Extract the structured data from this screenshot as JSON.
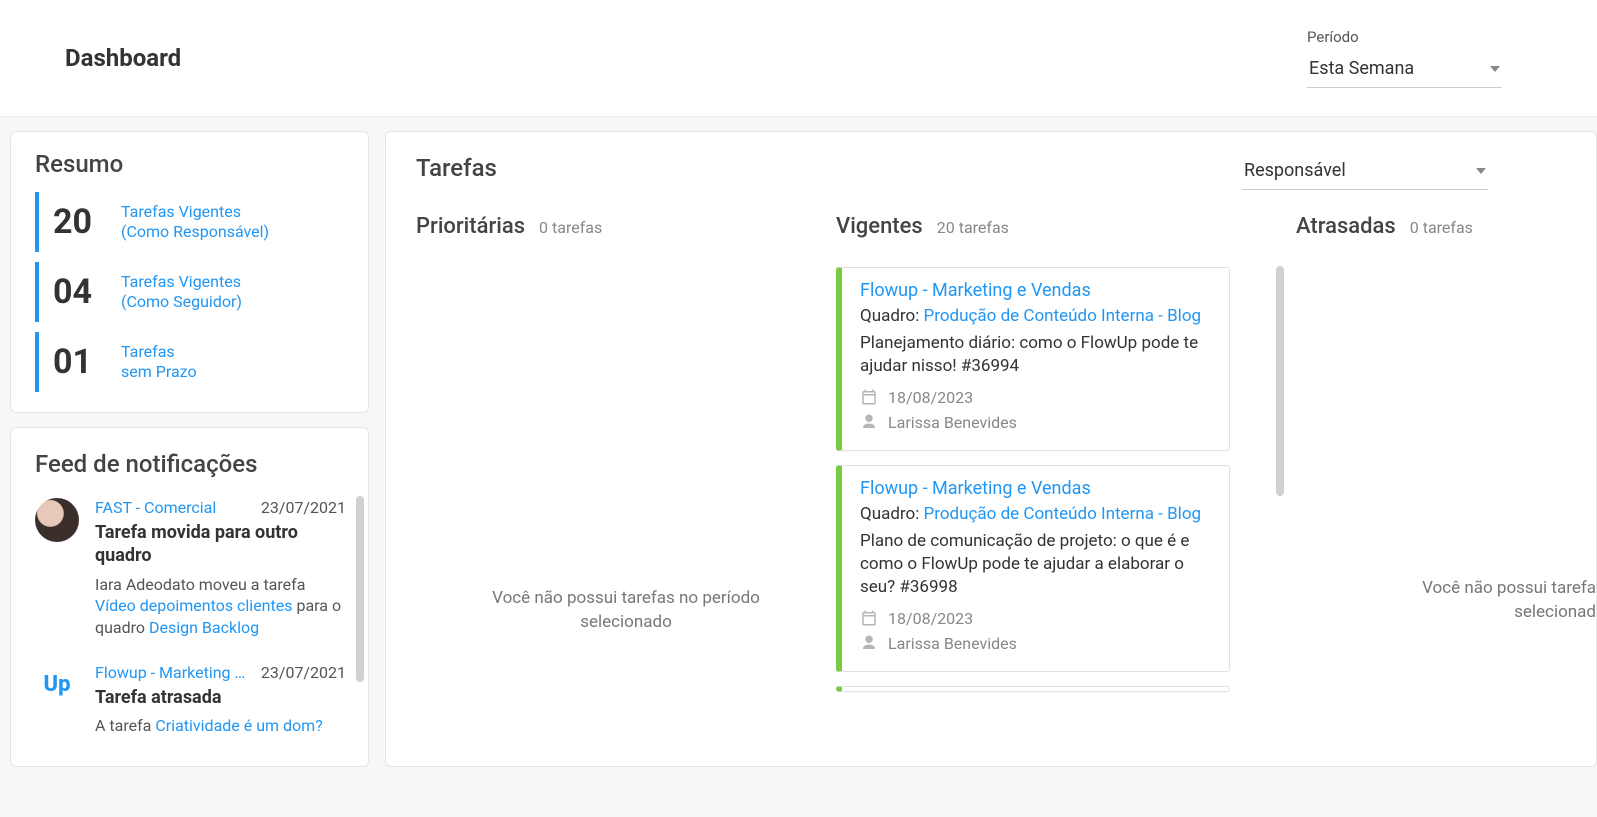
{
  "header": {
    "title": "Dashboard",
    "period_label": "Período",
    "period_value": "Esta Semana"
  },
  "resumo": {
    "title": "Resumo",
    "items": [
      {
        "value": "20",
        "label1": "Tarefas Vigentes",
        "label2": "(Como Responsável)"
      },
      {
        "value": "04",
        "label1": "Tarefas Vigentes",
        "label2": "(Como Seguidor)"
      },
      {
        "value": "01",
        "label1": "Tarefas",
        "label2": "sem Prazo"
      }
    ]
  },
  "feed": {
    "title": "Feed de notificações",
    "items": [
      {
        "source": "FAST - Comercial",
        "date": "23/07/2021",
        "headline": "Tarefa movida para outro quadro",
        "desc_pre": "Iara Adeodato moveu a tarefa ",
        "desc_link1": "Vídeo depoimentos clientes",
        "desc_mid": " para o quadro ",
        "desc_link2": "Design Backlog",
        "avatar": "photo"
      },
      {
        "source": "Flowup - Marketing …",
        "date": "23/07/2021",
        "headline": "Tarefa atrasada",
        "desc_pre": "A tarefa ",
        "desc_link1": "Criatividade é um dom?",
        "desc_mid": "",
        "desc_link2": "",
        "avatar": "up"
      }
    ]
  },
  "tarefas": {
    "title": "Tarefas",
    "responsavel_label": "Responsável",
    "columns": {
      "prioritarias": {
        "title": "Prioritárias",
        "count": "0 tarefas",
        "placeholder": "Você não possui tarefas no período selecionado"
      },
      "vigentes": {
        "title": "Vigentes",
        "count": "20 tarefas"
      },
      "atrasadas": {
        "title": "Atrasadas",
        "count": "0 tarefas",
        "placeholder": "Você não possui tarefa selecionad"
      }
    },
    "board_prefix": "Quadro: ",
    "vigentes_cards": [
      {
        "project": "Flowup - Marketing e Vendas",
        "board": "Produção de Conteúdo Interna - Blog",
        "task": "Planejamento diário: como o FlowUp pode te ajudar nisso! #36994",
        "date": "18/08/2023",
        "assignee": "Larissa Benevides"
      },
      {
        "project": "Flowup - Marketing e Vendas",
        "board": "Produção de Conteúdo Interna - Blog",
        "task": "Plano de comunicação de projeto: o que é e como o FlowUp pode te ajudar a elaborar o seu? #36998",
        "date": "18/08/2023",
        "assignee": "Larissa Benevides"
      }
    ]
  }
}
